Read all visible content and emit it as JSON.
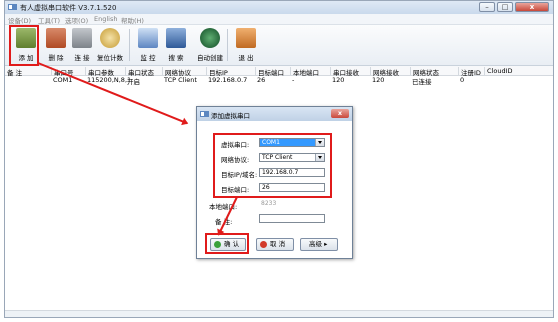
{
  "window": {
    "title": "有人虚拟串口软件 V3.7.1.520"
  },
  "window_controls": {
    "minimize": "–",
    "maximize": "□",
    "close": "x"
  },
  "menu": [
    "设备(D)",
    "工具(T)",
    "选项(O)",
    "English",
    "帮助(H)"
  ],
  "toolbar": [
    {
      "label": "添 加",
      "icon": "add-port-icon",
      "color": "#6a8e3c"
    },
    {
      "label": "删 除",
      "icon": "delete-port-icon",
      "color": "#c0562c"
    },
    {
      "label": "连 接",
      "icon": "connect-icon",
      "color": "#8a8f96"
    },
    {
      "label": "复位计数",
      "icon": "reset-counter-icon",
      "color": "#c9a443"
    },
    {
      "label": "监 控",
      "icon": "monitor-icon",
      "color": "#4a78b8"
    },
    {
      "label": "搜 索",
      "icon": "search-device-icon",
      "color": "#3f6aa8"
    },
    {
      "label": "自动创建",
      "icon": "auto-create-icon",
      "color": "#1f6a3a"
    },
    {
      "label": "退 出",
      "icon": "exit-icon",
      "color": "#c8702c"
    }
  ],
  "table": {
    "columns": [
      "备 注",
      "串口号",
      "串口参数",
      "串口状态",
      "网络协议",
      "目标IP",
      "目标端口",
      "本地端口",
      "串口接收",
      "网络接收",
      "网络状态",
      "注册ID",
      "CloudID"
    ],
    "rows": [
      [
        "",
        "COM1",
        "115200,N,8,1",
        "开启",
        "TCP Client",
        "192.168.0.7",
        "26",
        "-",
        "120",
        "120",
        "已连接",
        "0",
        ""
      ]
    ]
  },
  "dialog": {
    "title": "添加虚拟串口",
    "close": "x",
    "fields": {
      "virtual_port_label": "虚拟串口:",
      "virtual_port_value": "COM1",
      "protocol_label": "网络协议:",
      "protocol_value": "TCP Client",
      "target_ip_label": "目标IP/域名:",
      "target_ip_value": "192.168.0.7",
      "target_port_label": "目标端口:",
      "target_port_value": "26",
      "local_port_label": "本地端口:",
      "local_port_value": "8233",
      "remark_label": "备 注:",
      "remark_value": ""
    },
    "buttons": {
      "ok": "确 认",
      "cancel": "取 消",
      "advanced": "高级 ▸"
    }
  },
  "colors": {
    "highlight": "#e01b1b",
    "selection": "#3399ff"
  }
}
